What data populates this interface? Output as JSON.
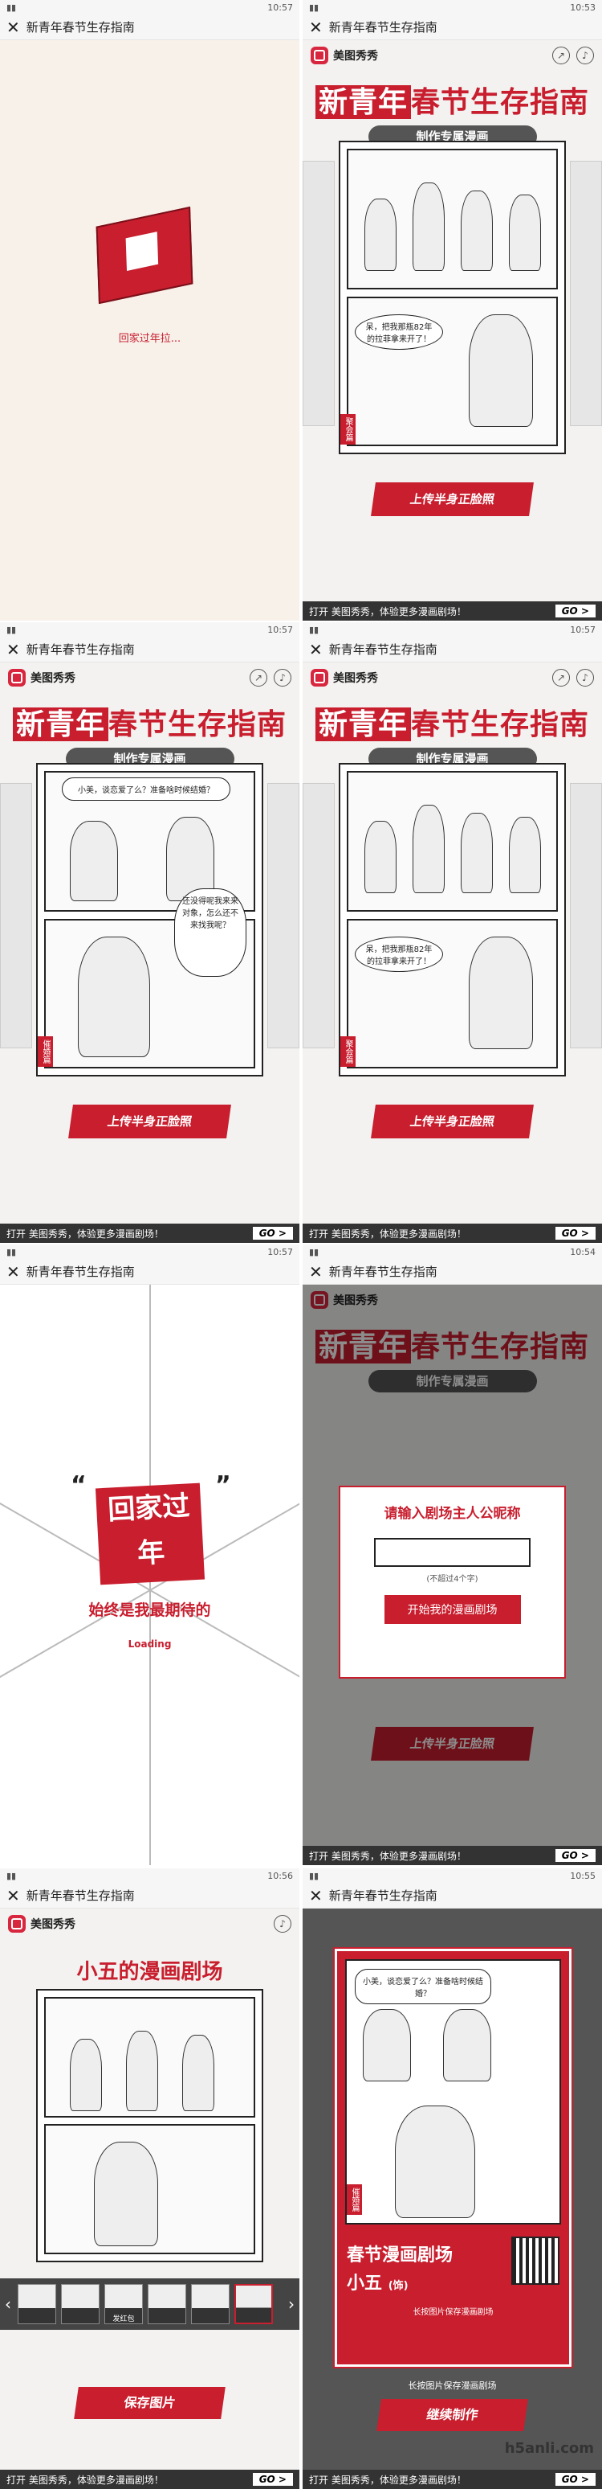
{
  "nav_title": "新青年春节生存指南",
  "times": [
    "10:57",
    "10:53",
    "10:57",
    "10:57",
    "10:57",
    "10:54",
    "10:56",
    "10:55"
  ],
  "app_name": "美图秀秀",
  "intro": {
    "caption": "回家过年拉..."
  },
  "banner": {
    "title_a": "新青年",
    "title_b": "春节生存指南",
    "subtitle": "制作专属漫画"
  },
  "comics": {
    "panel_a_bubble": "呆，把我那瓶82年的拉菲拿来开了！",
    "panel_b_top": "小美，谈恋爱了么？准备啥时候结婚？",
    "panel_b_side": "还没得呢我来来对象，怎么还不来找我呢？",
    "stamp_a": "聚会篇",
    "stamp_b": "催婚篇"
  },
  "upload_btn": "上传半身正脸照",
  "bottom": {
    "text": "打开 美图秀秀，体验更多漫画剧场！",
    "go": "GO >"
  },
  "loading": {
    "badge": "回家过年",
    "slogan": "始终是我最期待的",
    "status": "Loading"
  },
  "modal": {
    "title": "请输入剧场主人公昵称",
    "hint": "(不超过4个字)",
    "start": "开始我的漫画剧场"
  },
  "theater": {
    "title": "小五的漫画剧场",
    "thumbs": [
      "",
      "",
      "发红包",
      "",
      "",
      "",
      ""
    ],
    "save": "保存图片"
  },
  "poster": {
    "title": "春节漫画剧场",
    "name": "小五",
    "suffix": "(饰)",
    "note": "长按图片保存漫画剧场",
    "tip": "长按图片保存漫画剧场",
    "continue": "继续制作",
    "stamp": "催婚篇"
  },
  "watermark": "h5anli.com"
}
